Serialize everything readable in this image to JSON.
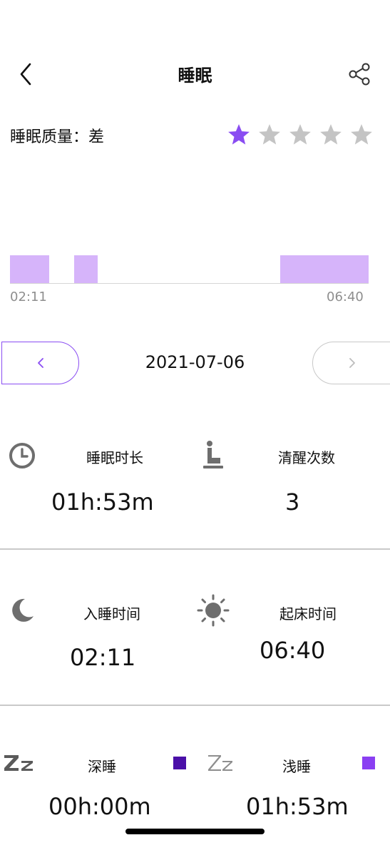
{
  "header": {
    "title": "睡眠"
  },
  "quality": {
    "label": "睡眠质量：差",
    "rating": 1,
    "max_rating": 5,
    "active_color": "#8a4df2",
    "inactive_color": "#c4c4c4"
  },
  "timeline": {
    "start_label": "02:11",
    "end_label": "06:40",
    "segment_color": "#d6b4fa",
    "segments": [
      {
        "start_fraction": 0.0,
        "end_fraction": 0.11
      },
      {
        "start_fraction": 0.178,
        "end_fraction": 0.245
      },
      {
        "start_fraction": 0.754,
        "end_fraction": 1.0
      }
    ]
  },
  "date_nav": {
    "date": "2021-07-06",
    "prev_symbol": "‹",
    "next_symbol": "›"
  },
  "stats": {
    "duration": {
      "label": "睡眠时长",
      "value": "01h:53m",
      "icon": "clock-icon"
    },
    "awake": {
      "label": "清醒次数",
      "value": "3",
      "icon": "seated-person-icon"
    },
    "sleep_time": {
      "label": "入睡时间",
      "value": "02:11",
      "icon": "moon-icon"
    },
    "wake_time": {
      "label": "起床时间",
      "value": "06:40",
      "icon": "sun-icon"
    },
    "deep": {
      "label": "深睡",
      "value": "00h:00m",
      "icon": "zz-icon",
      "color": "#4a0fa8"
    },
    "light": {
      "label": "浅睡",
      "value": "01h:53m",
      "icon": "zz-icon",
      "color": "#8a3ff2"
    }
  }
}
